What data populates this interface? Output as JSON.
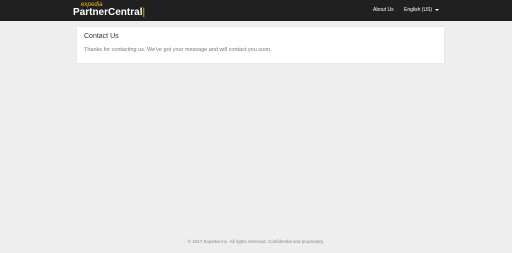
{
  "header": {
    "logo_top": "expedia",
    "logo_main": "PartnerCentral",
    "nav": {
      "about": "About Us",
      "language": "English (US)"
    }
  },
  "card": {
    "title": "Contact Us",
    "message": "Thanks for contacting us. We've got your message and will contact you soon."
  },
  "footer": {
    "text": "© 2017 Expedia Inc. All rights reserved. Confidential and proprietary."
  },
  "colors": {
    "header_bg": "#202020",
    "brand_accent": "#f3c300",
    "page_bg": "#eeeeee",
    "card_bg": "#ffffff"
  }
}
